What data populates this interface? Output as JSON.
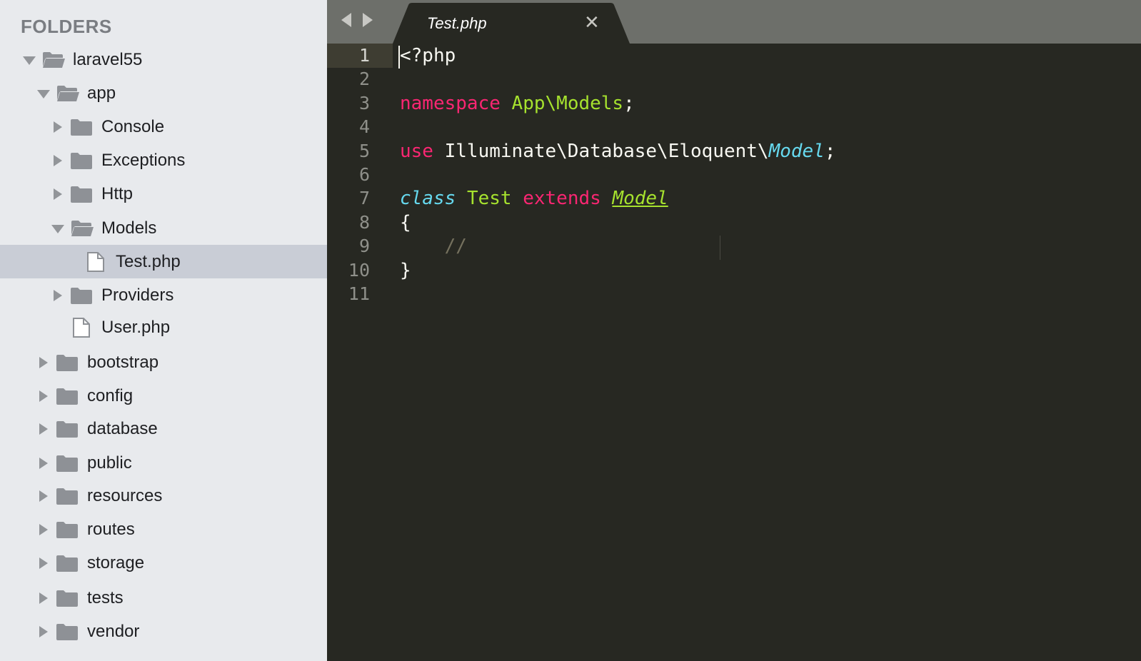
{
  "sidebar": {
    "title": "FOLDERS",
    "items": [
      {
        "label": "laravel55",
        "type": "folder",
        "state": "open",
        "depth": 0
      },
      {
        "label": "app",
        "type": "folder",
        "state": "open",
        "depth": 1
      },
      {
        "label": "Console",
        "type": "folder",
        "state": "closed",
        "depth": 2
      },
      {
        "label": "Exceptions",
        "type": "folder",
        "state": "closed",
        "depth": 2
      },
      {
        "label": "Http",
        "type": "folder",
        "state": "closed",
        "depth": 2
      },
      {
        "label": "Models",
        "type": "folder",
        "state": "open",
        "depth": 2
      },
      {
        "label": "Test.php",
        "type": "file",
        "state": "none",
        "depth": 3,
        "selected": true
      },
      {
        "label": "Providers",
        "type": "folder",
        "state": "closed",
        "depth": 2
      },
      {
        "label": "User.php",
        "type": "file",
        "state": "none",
        "depth": 2
      },
      {
        "label": "bootstrap",
        "type": "folder",
        "state": "closed",
        "depth": 1
      },
      {
        "label": "config",
        "type": "folder",
        "state": "closed",
        "depth": 1
      },
      {
        "label": "database",
        "type": "folder",
        "state": "closed",
        "depth": 1
      },
      {
        "label": "public",
        "type": "folder",
        "state": "closed",
        "depth": 1
      },
      {
        "label": "resources",
        "type": "folder",
        "state": "closed",
        "depth": 1
      },
      {
        "label": "routes",
        "type": "folder",
        "state": "closed",
        "depth": 1
      },
      {
        "label": "storage",
        "type": "folder",
        "state": "closed",
        "depth": 1
      },
      {
        "label": "tests",
        "type": "folder",
        "state": "closed",
        "depth": 1
      },
      {
        "label": "vendor",
        "type": "folder",
        "state": "closed",
        "depth": 1
      }
    ]
  },
  "tabs": [
    {
      "title": "Test.php",
      "close_glyph": "✕",
      "active": true
    }
  ],
  "editor": {
    "active_line": 1,
    "line_numbers": [
      "1",
      "2",
      "3",
      "4",
      "5",
      "6",
      "7",
      "8",
      "9",
      "10",
      "11"
    ],
    "lines": [
      [
        {
          "t": "<?php",
          "c": "plain"
        }
      ],
      [],
      [
        {
          "t": "namespace",
          "c": "kw"
        },
        {
          "t": " ",
          "c": "plain"
        },
        {
          "t": "App\\Models",
          "c": "ent"
        },
        {
          "t": ";",
          "c": "plain"
        }
      ],
      [],
      [
        {
          "t": "use",
          "c": "kw"
        },
        {
          "t": " Illuminate\\Database\\Eloquent\\",
          "c": "plain"
        },
        {
          "t": "Model",
          "c": "type"
        },
        {
          "t": ";",
          "c": "plain"
        }
      ],
      [],
      [
        {
          "t": "class",
          "c": "type"
        },
        {
          "t": " ",
          "c": "plain"
        },
        {
          "t": "Test",
          "c": "ent"
        },
        {
          "t": " ",
          "c": "plain"
        },
        {
          "t": "extends",
          "c": "kw"
        },
        {
          "t": " ",
          "c": "plain"
        },
        {
          "t": "Model",
          "c": "inherit"
        }
      ],
      [
        {
          "t": "{",
          "c": "plain"
        }
      ],
      [
        {
          "t": "    ",
          "c": "plain"
        },
        {
          "t": "//",
          "c": "comment"
        }
      ],
      [
        {
          "t": "}",
          "c": "plain"
        }
      ],
      []
    ]
  },
  "colors": {
    "sidebar_bg": "#e8eaed",
    "selected_row": "#c9cdd6",
    "editor_bg": "#272822",
    "keyword": "#f92672",
    "entity": "#a6e22e",
    "type": "#66d9ef",
    "comment": "#75715e"
  },
  "icons": {
    "folder_closed": "folder-icon",
    "folder_open": "folder-open-icon",
    "file": "file-icon",
    "nav_back": "arrow-left-icon",
    "nav_forward": "arrow-right-icon",
    "close": "close-icon"
  }
}
